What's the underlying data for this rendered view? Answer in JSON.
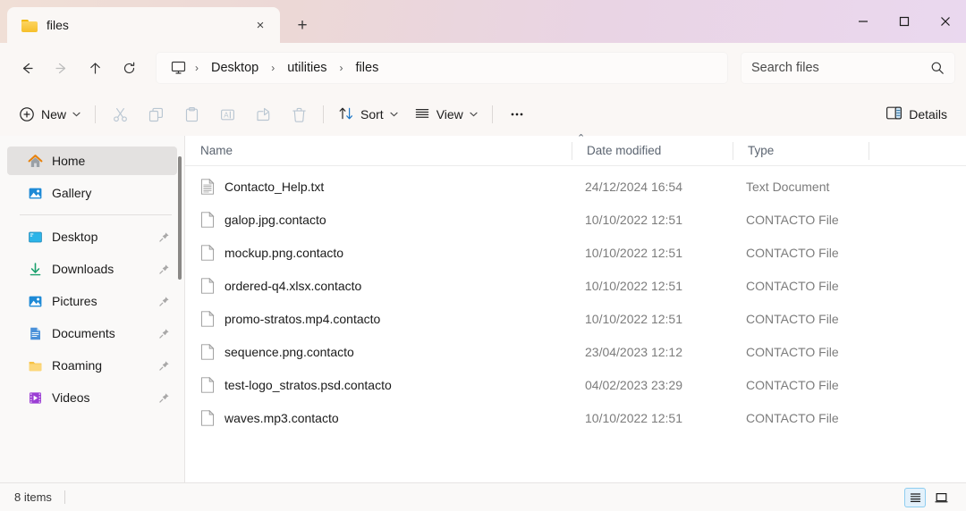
{
  "window": {
    "titlebar_colors": {
      "start": "#f0dfd6",
      "end": "#ead8ef"
    },
    "minimize_label": "Minimize",
    "maximize_label": "Maximize",
    "close_label": "Close"
  },
  "tab": {
    "title": "files",
    "close_label": "×",
    "new_tab_label": "+"
  },
  "nav": {
    "back_label": "Back",
    "forward_label": "Forward",
    "up_label": "Up",
    "refresh_label": "Refresh"
  },
  "breadcrumb": {
    "root_icon": "this-pc-icon",
    "separator": "›",
    "segments": [
      "Desktop",
      "utilities",
      "files"
    ]
  },
  "search": {
    "placeholder": "Search files",
    "icon": "search-icon"
  },
  "toolbar": {
    "new_label": "New",
    "cut_label": "Cut",
    "copy_label": "Copy",
    "paste_label": "Paste",
    "rename_label": "Rename",
    "share_label": "Share",
    "delete_label": "Delete",
    "sort_label": "Sort",
    "view_label": "View",
    "more_label": "•••",
    "details_label": "Details",
    "chevron": "⌄"
  },
  "sidebar": {
    "items": [
      {
        "label": "Home",
        "icon": "home-icon",
        "selected": true,
        "pinned": false
      },
      {
        "label": "Gallery",
        "icon": "gallery-icon",
        "selected": false,
        "pinned": false
      },
      {
        "label": "Desktop",
        "icon": "desktop-icon",
        "selected": false,
        "pinned": true
      },
      {
        "label": "Downloads",
        "icon": "downloads-icon",
        "selected": false,
        "pinned": true
      },
      {
        "label": "Pictures",
        "icon": "pictures-icon",
        "selected": false,
        "pinned": true
      },
      {
        "label": "Documents",
        "icon": "documents-icon",
        "selected": false,
        "pinned": true
      },
      {
        "label": "Roaming",
        "icon": "folder-icon",
        "selected": false,
        "pinned": true
      },
      {
        "label": "Videos",
        "icon": "videos-icon",
        "selected": false,
        "pinned": true
      }
    ]
  },
  "filelist": {
    "columns": {
      "name": "Name",
      "date_modified": "Date modified",
      "type": "Type"
    },
    "sort_indicator": "⌃",
    "rows": [
      {
        "name": "Contacto_Help.txt",
        "date": "24/12/2024 16:54",
        "type": "Text Document",
        "icon": "text-file-icon"
      },
      {
        "name": "galop.jpg.contacto",
        "date": "10/10/2022 12:51",
        "type": "CONTACTO File",
        "icon": "generic-file-icon"
      },
      {
        "name": "mockup.png.contacto",
        "date": "10/10/2022 12:51",
        "type": "CONTACTO File",
        "icon": "generic-file-icon"
      },
      {
        "name": "ordered-q4.xlsx.contacto",
        "date": "10/10/2022 12:51",
        "type": "CONTACTO File",
        "icon": "generic-file-icon"
      },
      {
        "name": "promo-stratos.mp4.contacto",
        "date": "10/10/2022 12:51",
        "type": "CONTACTO File",
        "icon": "generic-file-icon"
      },
      {
        "name": "sequence.png.contacto",
        "date": "23/04/2023 12:12",
        "type": "CONTACTO File",
        "icon": "generic-file-icon"
      },
      {
        "name": "test-logo_stratos.psd.contacto",
        "date": "04/02/2023 23:29",
        "type": "CONTACTO File",
        "icon": "generic-file-icon"
      },
      {
        "name": "waves.mp3.contacto",
        "date": "10/10/2022 12:51",
        "type": "CONTACTO File",
        "icon": "generic-file-icon"
      }
    ]
  },
  "statusbar": {
    "item_count": "8 items",
    "details_view_label": "Details view",
    "large_icons_view_label": "Large icons view"
  }
}
